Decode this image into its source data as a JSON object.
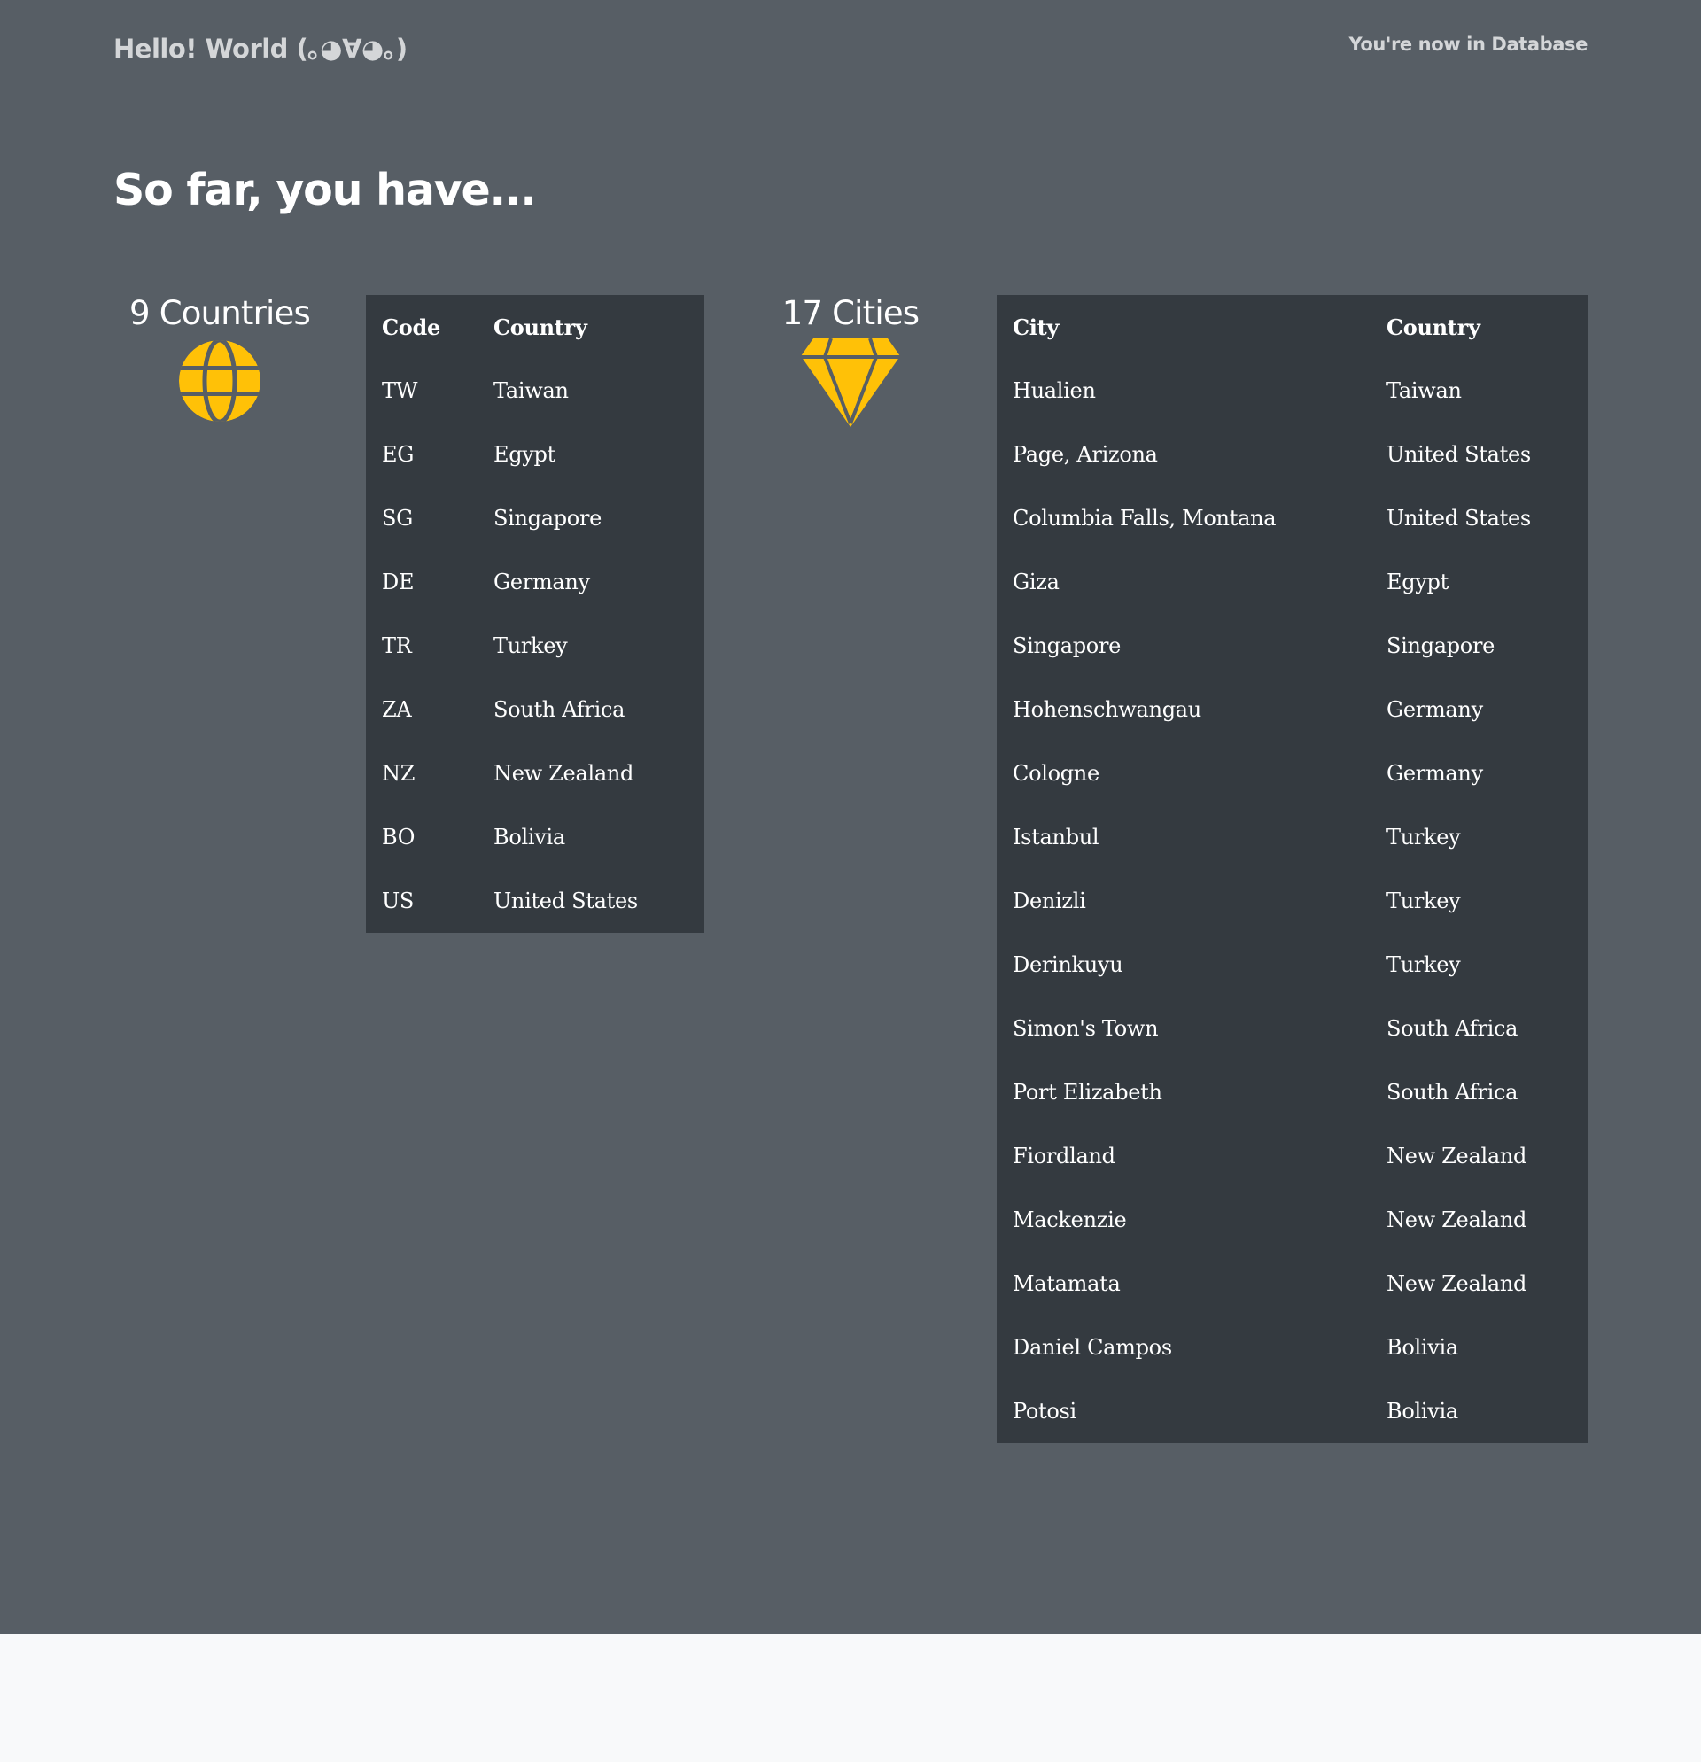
{
  "header": {
    "brand": "Hello! World (｡◕∀◕｡)",
    "status": "You're now in Database"
  },
  "main": {
    "headline": "So far, you have..."
  },
  "countries": {
    "count_label": "9 Countries",
    "icon": "globe-icon",
    "headers": [
      "Code",
      "Country"
    ],
    "rows": [
      {
        "code": "TW",
        "country": "Taiwan"
      },
      {
        "code": "EG",
        "country": "Egypt"
      },
      {
        "code": "SG",
        "country": "Singapore"
      },
      {
        "code": "DE",
        "country": "Germany"
      },
      {
        "code": "TR",
        "country": "Turkey"
      },
      {
        "code": "ZA",
        "country": "South Africa"
      },
      {
        "code": "NZ",
        "country": "New Zealand"
      },
      {
        "code": "BO",
        "country": "Bolivia"
      },
      {
        "code": "US",
        "country": "United States"
      }
    ]
  },
  "cities": {
    "count_label": "17 Cities",
    "icon": "gem-icon",
    "headers": [
      "City",
      "Country"
    ],
    "rows": [
      {
        "city": "Hualien",
        "country": "Taiwan"
      },
      {
        "city": "Page, Arizona",
        "country": "United States"
      },
      {
        "city": "Columbia Falls, Montana",
        "country": "United States"
      },
      {
        "city": "Giza",
        "country": "Egypt"
      },
      {
        "city": "Singapore",
        "country": "Singapore"
      },
      {
        "city": "Hohenschwangau",
        "country": "Germany"
      },
      {
        "city": "Cologne",
        "country": "Germany"
      },
      {
        "city": "Istanbul",
        "country": "Turkey"
      },
      {
        "city": "Denizli",
        "country": "Turkey"
      },
      {
        "city": "Derinkuyu",
        "country": "Turkey"
      },
      {
        "city": "Simon's Town",
        "country": "South Africa"
      },
      {
        "city": "Port Elizabeth",
        "country": "South Africa"
      },
      {
        "city": "Fiordland",
        "country": "New Zealand"
      },
      {
        "city": "Mackenzie",
        "country": "New Zealand"
      },
      {
        "city": "Matamata",
        "country": "New Zealand"
      },
      {
        "city": "Daniel Campos",
        "country": "Bolivia"
      },
      {
        "city": "Potosi",
        "country": "Bolivia"
      }
    ]
  },
  "colors": {
    "page_background": "#575e65",
    "table_background": "#343a40",
    "icon_accent": "#ffc107",
    "footer_background": "#f8f9fa"
  }
}
